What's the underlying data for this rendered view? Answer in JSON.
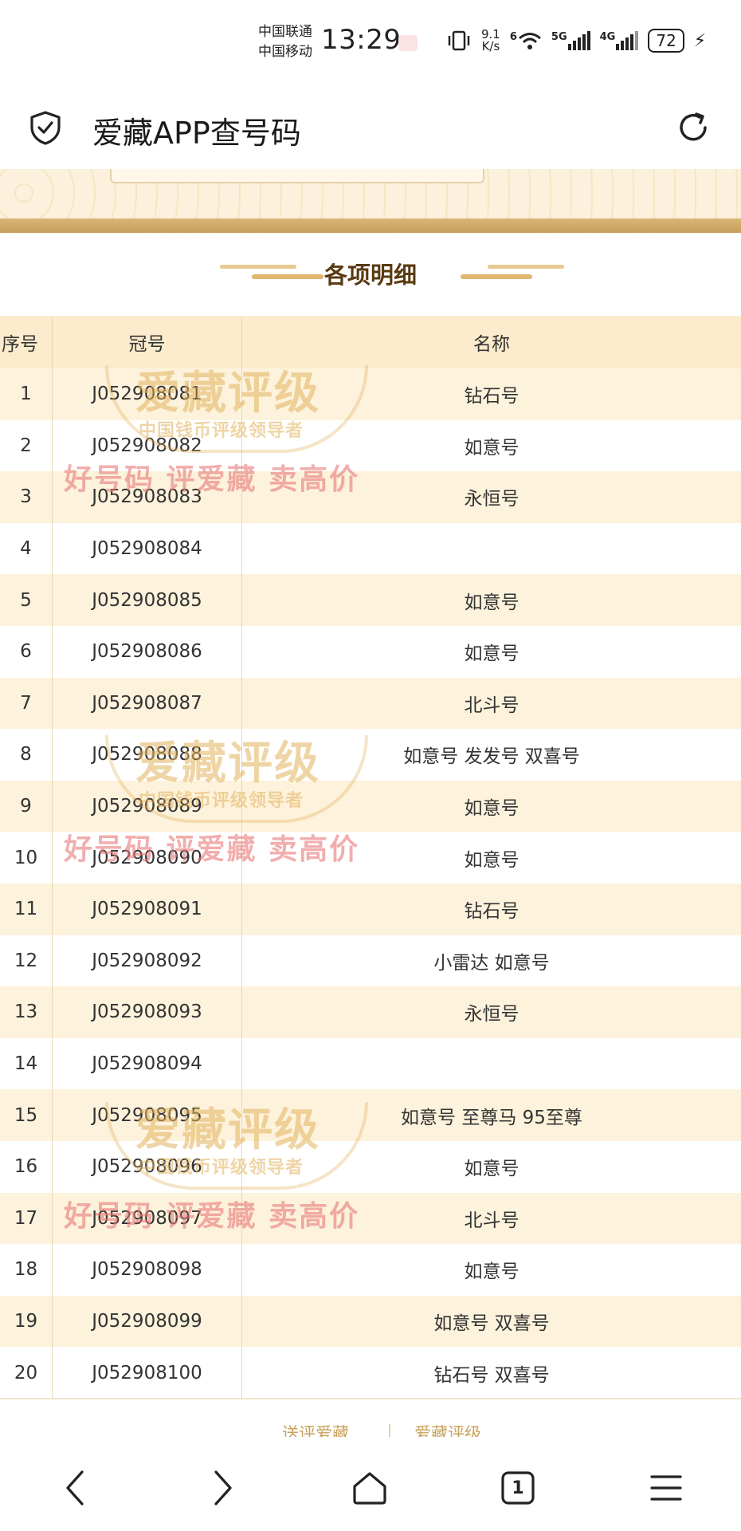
{
  "status_bar": {
    "carrier_1": "中国联通",
    "carrier_2": "中国移动",
    "time": "13:29",
    "net_speed_value": "9.1",
    "net_speed_unit": "K/s",
    "wifi_label": "6",
    "signal_1_label": "5G",
    "signal_2_label": "4G",
    "battery": "72"
  },
  "browser": {
    "title": "爱藏APP查号码"
  },
  "section": {
    "title": "各项明细"
  },
  "table": {
    "headers": [
      "序号",
      "冠号",
      "名称"
    ],
    "rows": [
      [
        "1",
        "J052908081",
        "钻石号"
      ],
      [
        "2",
        "J052908082",
        "如意号"
      ],
      [
        "3",
        "J052908083",
        "永恒号"
      ],
      [
        "4",
        "J052908084",
        ""
      ],
      [
        "5",
        "J052908085",
        "如意号"
      ],
      [
        "6",
        "J052908086",
        "如意号"
      ],
      [
        "7",
        "J052908087",
        "北斗号"
      ],
      [
        "8",
        "J052908088",
        "如意号 发发号 双喜号"
      ],
      [
        "9",
        "J052908089",
        "如意号"
      ],
      [
        "10",
        "J052908090",
        "如意号"
      ],
      [
        "11",
        "J052908091",
        "钻石号"
      ],
      [
        "12",
        "J052908092",
        "小雷达 如意号"
      ],
      [
        "13",
        "J052908093",
        "永恒号"
      ],
      [
        "14",
        "J052908094",
        ""
      ],
      [
        "15",
        "J052908095",
        "如意号 至尊马  95至尊"
      ],
      [
        "16",
        "J052908096",
        "如意号"
      ],
      [
        "17",
        "J052908097",
        "北斗号"
      ],
      [
        "18",
        "J052908098",
        "如意号"
      ],
      [
        "19",
        "J052908099",
        "如意号 双喜号"
      ],
      [
        "20",
        "J052908100",
        "钻石号 双喜号"
      ]
    ]
  },
  "watermark": {
    "main": "爱藏评级",
    "sub": "中国钱币评级领导者",
    "slogan": "好号码 评爱藏 卖高价"
  },
  "footer": {
    "link_1": "送评爱藏",
    "link_2": "爱藏评级"
  },
  "nav": {
    "tab_count": "1"
  },
  "colors": {
    "header_row": "#fcebcc",
    "stripe_row": "#fdf2dc",
    "gold_band": "#d8b577",
    "title_brown": "#5a3a12",
    "watermark_gold": "#e2b25c",
    "watermark_red": "#e87878"
  }
}
